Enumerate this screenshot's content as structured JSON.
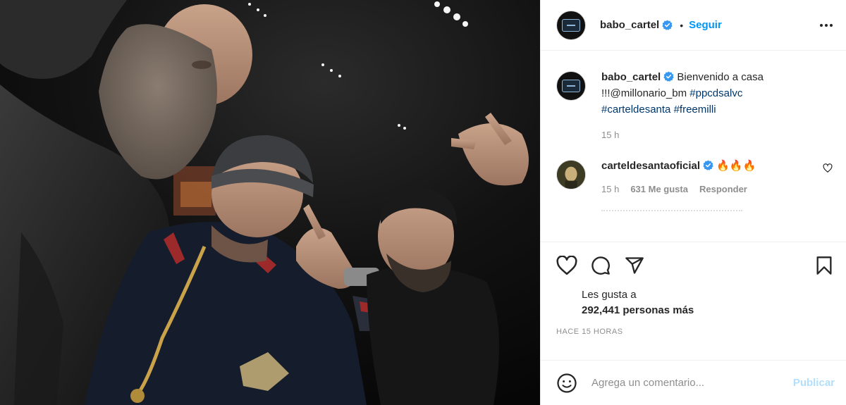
{
  "post": {
    "username": "babo_cartel",
    "follow_label": "Seguir",
    "separator": "•",
    "caption": {
      "text": "Bienvenido a casa !!!@millonario_bm",
      "tags": [
        "#ppcdsalvc",
        "#carteldesanta",
        "#freemilli"
      ],
      "time": "15 h"
    },
    "comments": [
      {
        "username": "carteldesantaoficial",
        "text": "🔥🔥🔥",
        "time": "15 h",
        "likes": "631 Me gusta",
        "reply_label": "Responder"
      }
    ],
    "likes_label": "Les gusta a",
    "likes_count": "292,441 personas más",
    "age": "HACE 15 HORAS",
    "comment_placeholder": "Agrega un comentario...",
    "publish_label": "Publicar"
  },
  "icons": {
    "verified": "verified-badge-icon",
    "more": "more-options-icon",
    "like": "heart-icon",
    "comment": "comment-icon",
    "share": "share-icon",
    "save": "bookmark-icon",
    "emoji": "emoji-icon",
    "comment_like": "small-heart-icon"
  },
  "colors": {
    "accent": "#0095f6",
    "verified": "#3897f0",
    "publish_disabled": "#b2dffc",
    "muted": "#8e8e8e"
  }
}
